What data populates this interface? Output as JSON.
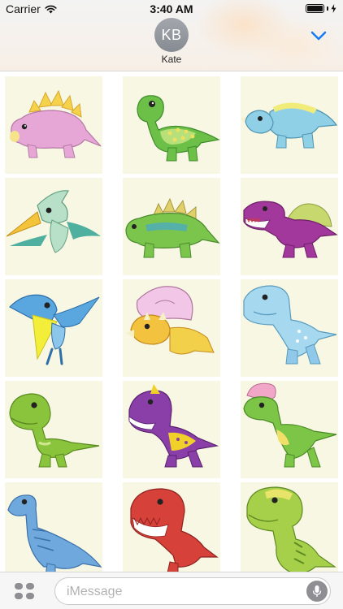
{
  "status_bar": {
    "carrier": "Carrier",
    "time": "3:40 AM"
  },
  "conversation": {
    "avatar_initials": "KB",
    "contact_name": "Kate"
  },
  "stickers": [
    {
      "name": "pink-stegosaurus"
    },
    {
      "name": "green-ankylosaurus"
    },
    {
      "name": "blue-triceratops"
    },
    {
      "name": "teal-pteranodon"
    },
    {
      "name": "green-kentrosaurus"
    },
    {
      "name": "purple-spinosaurus"
    },
    {
      "name": "blue-pterodactyl"
    },
    {
      "name": "yellow-pink-triceratops"
    },
    {
      "name": "blue-carnotaurus"
    },
    {
      "name": "green-raptor"
    },
    {
      "name": "purple-allosaurus"
    },
    {
      "name": "pink-crested-dilophosaurus"
    },
    {
      "name": "blue-brachiosaurus"
    },
    {
      "name": "red-t-rex"
    },
    {
      "name": "green-t-rex"
    }
  ],
  "input_bar": {
    "placeholder": "iMessage"
  },
  "colors": {
    "sticker_background": "#f8f7e3",
    "avatar": "#9a9ea4",
    "accent": "#1a7cf5"
  }
}
